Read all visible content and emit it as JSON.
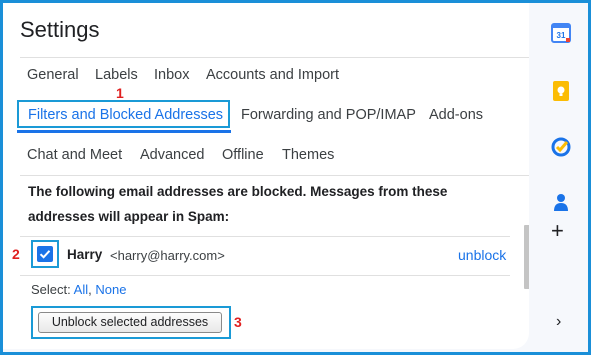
{
  "settings": {
    "title": "Settings"
  },
  "tabs": {
    "row1": [
      "General",
      "Labels",
      "Inbox",
      "Accounts and Import"
    ],
    "row2": [
      "Filters and Blocked Addresses",
      "Forwarding and POP/IMAP",
      "Add-ons"
    ],
    "row3": [
      "Chat and Meet",
      "Advanced",
      "Offline",
      "Themes"
    ],
    "active": "Filters and Blocked Addresses"
  },
  "annotations": {
    "marker1": "1",
    "marker2": "2",
    "marker3": "3"
  },
  "blocked": {
    "description": "The following email addresses are blocked. Messages from these addresses will appear in Spam:",
    "entries": [
      {
        "name": "Harry",
        "email": "<harry@harry.com>",
        "action": "unblock",
        "checked": true
      }
    ],
    "select_label": "Select:",
    "select_all": "All",
    "select_none": "None",
    "unblock_button": "Unblock selected addresses"
  },
  "side_panel": {
    "icons": [
      "calendar-icon",
      "keep-icon",
      "tasks-icon",
      "contacts-icon",
      "add-icon",
      "chevron-right-icon"
    ],
    "calendar_day": "31"
  },
  "colors": {
    "accent": "#1a73e8",
    "annotation_frame": "#1a9ad6",
    "annotation_number": "#e02020"
  }
}
